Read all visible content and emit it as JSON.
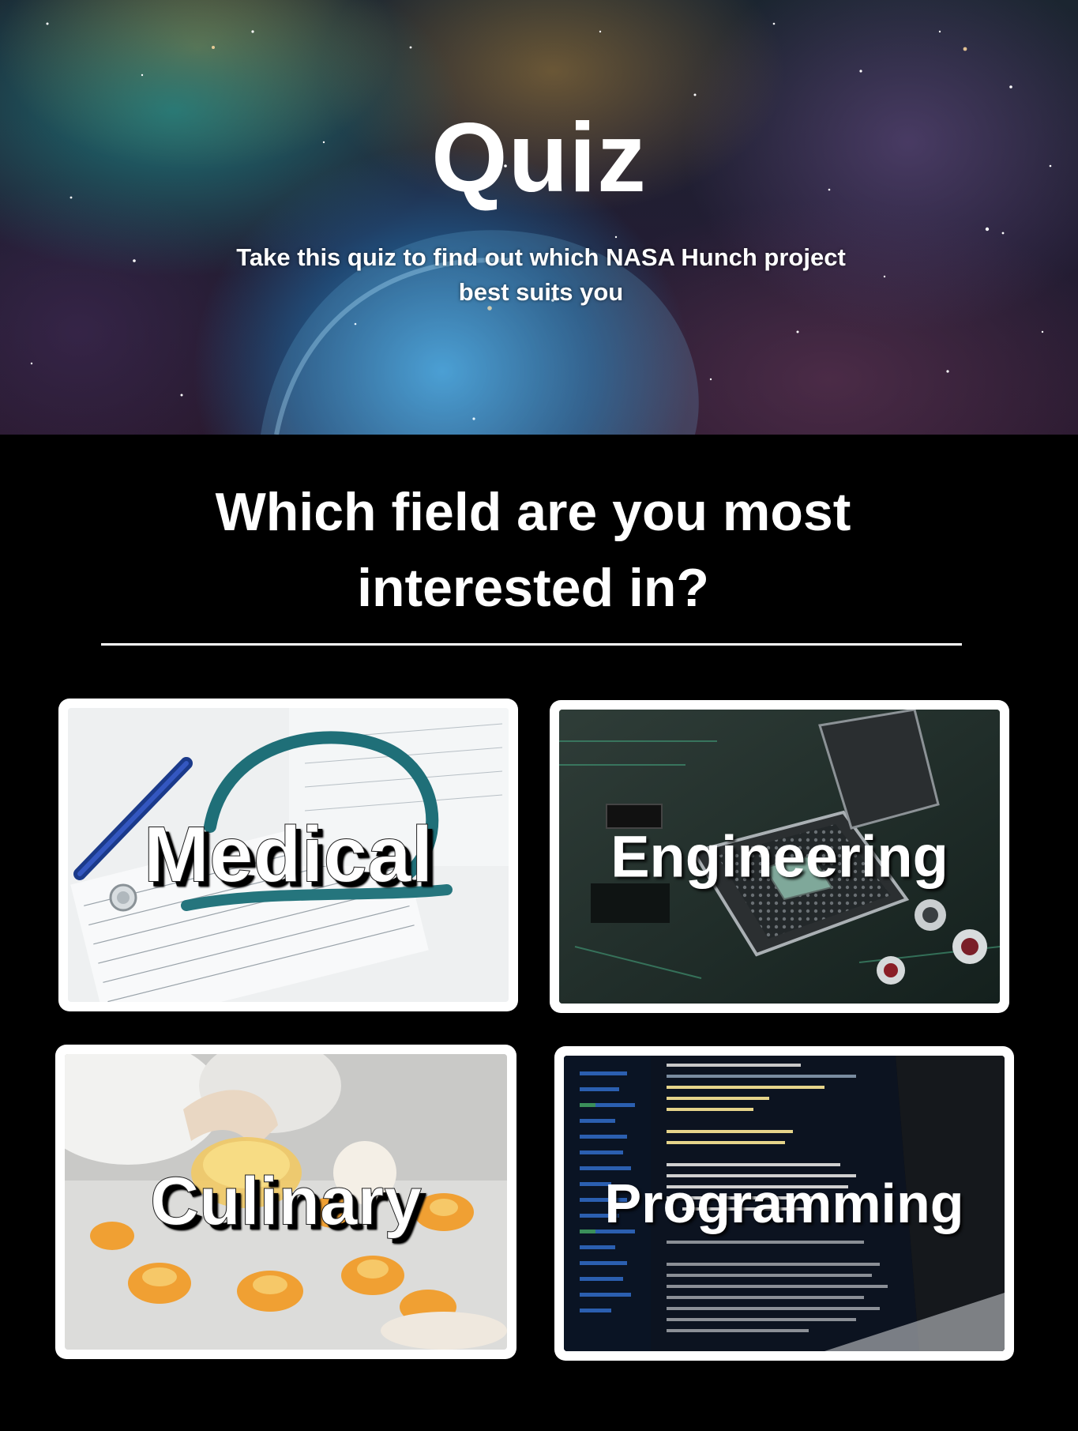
{
  "hero": {
    "title": "Quiz",
    "subtitle": "Take this quiz to find out which NASA Hunch project best suits you"
  },
  "question": {
    "text": "Which field are you most interested in?"
  },
  "options": [
    {
      "id": "medical",
      "label": "Medical",
      "image": "stethoscope-on-medical-form"
    },
    {
      "id": "engineering",
      "label": "Engineering",
      "image": "cpu-socket-circuit-board"
    },
    {
      "id": "culinary",
      "label": "Culinary",
      "image": "chef-plating-food"
    },
    {
      "id": "programming",
      "label": "Programming",
      "image": "code-editor-on-laptop"
    }
  ],
  "colors": {
    "background": "#000000",
    "text": "#ffffff",
    "card_border": "#ffffff"
  }
}
